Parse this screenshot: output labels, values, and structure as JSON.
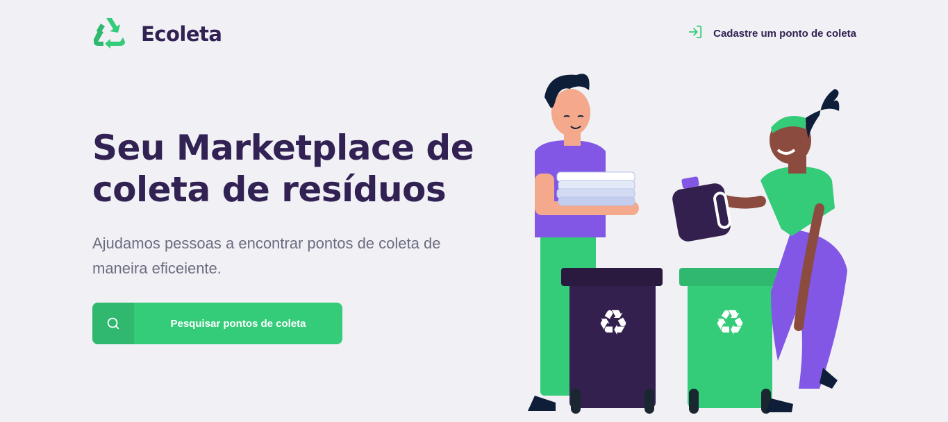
{
  "header": {
    "logo_text": "Ecoleta",
    "logo_icon": "recycle-icon",
    "register_link": "Cadastre um ponto de coleta",
    "register_icon": "log-in-icon"
  },
  "hero": {
    "title": "Seu Marketplace de coleta de resíduos",
    "subtitle": "Ajudamos pessoas a encontrar pontos de coleta de maneira eficeiente.",
    "cta_label": "Pesquisar pontos de coleta",
    "cta_icon": "search-icon"
  },
  "colors": {
    "background": "#F0F0F5",
    "primary": "#34CB79",
    "primary_dark": "#2FB86E",
    "title": "#322153",
    "text": "#6C6C80",
    "purple_bin": "#34204F",
    "purple_accent": "#8257E5"
  }
}
